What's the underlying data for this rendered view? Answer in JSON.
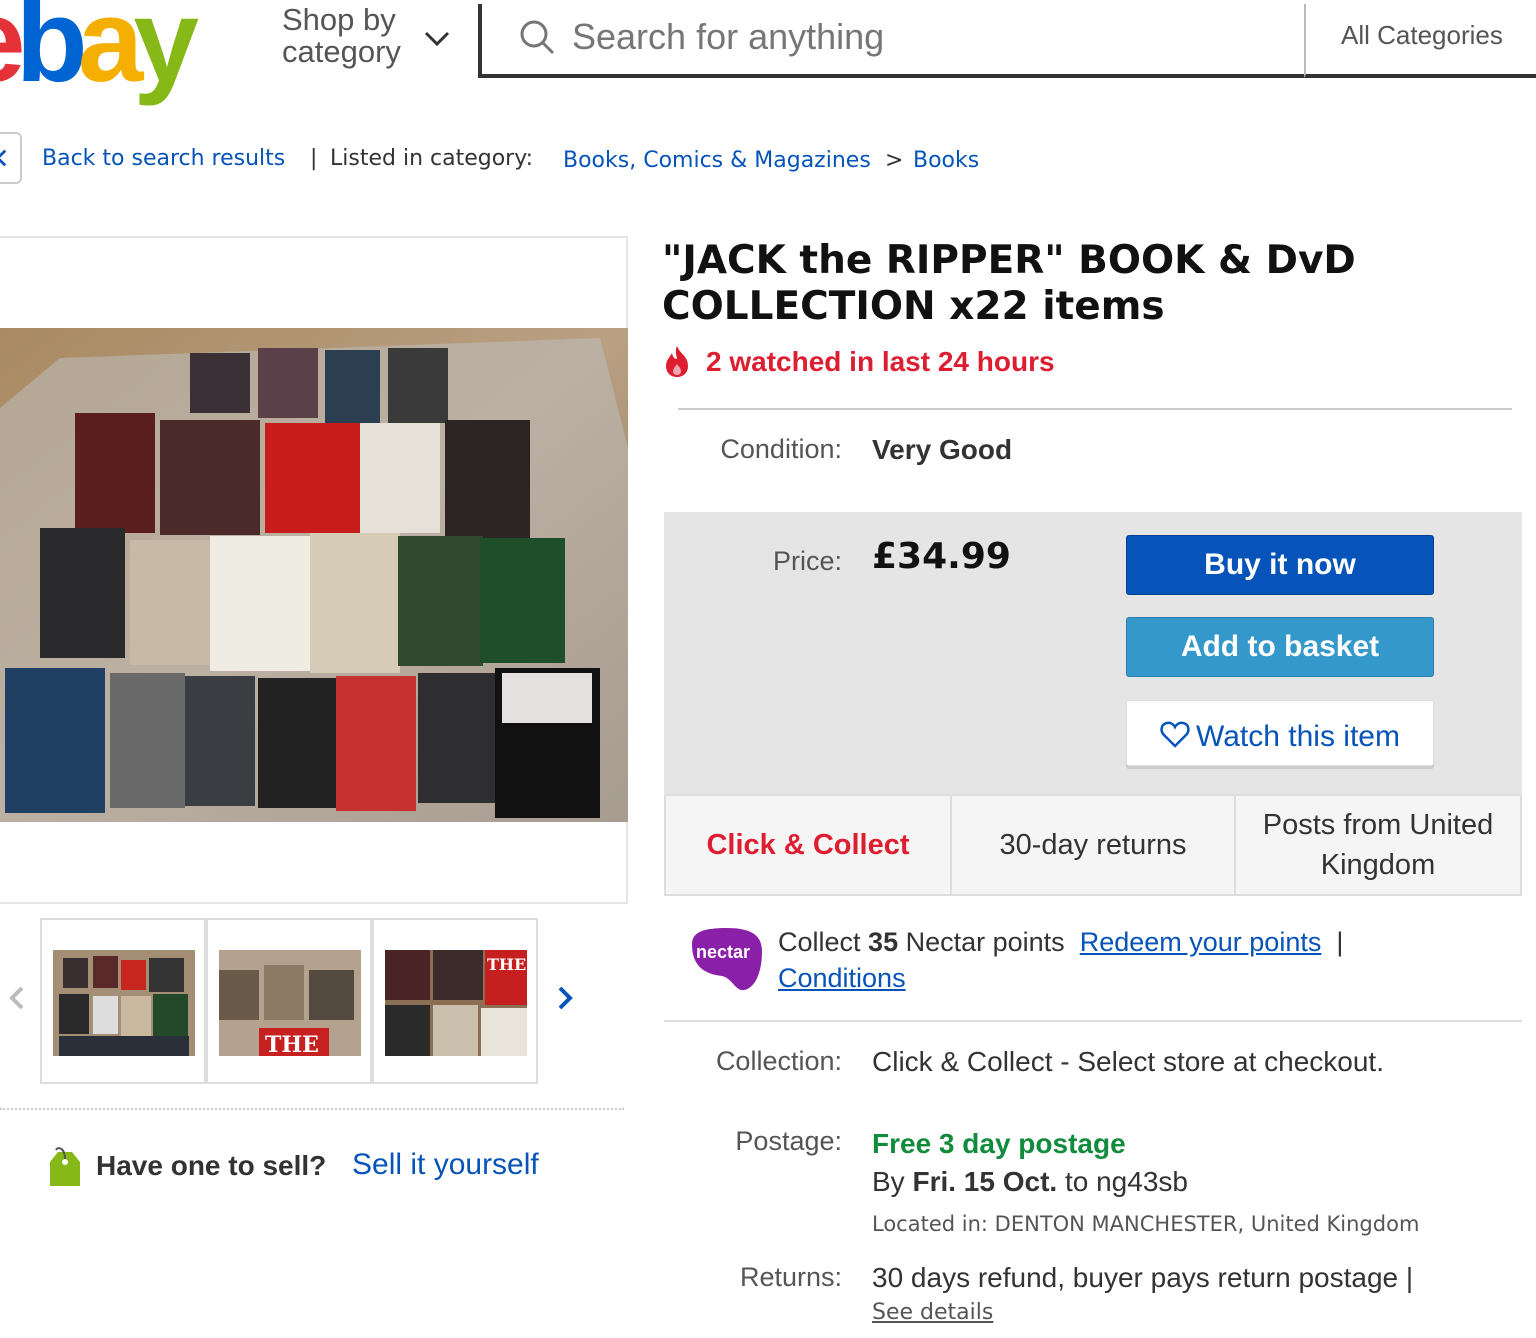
{
  "header": {
    "logo": {
      "e": "e",
      "b": "b",
      "a": "a",
      "y": "y"
    },
    "shop_by_line1": "Shop by",
    "shop_by_line2": "category",
    "search_placeholder": "Search for anything",
    "all_categories": "All Categories"
  },
  "breadcrumb": {
    "back": "Back to search results",
    "separator": "|",
    "listed_in": "Listed in category:",
    "category": "Books, Comics & Magazines",
    "arrow": ">",
    "subcategory": "Books"
  },
  "listing": {
    "title": "\"JACK the RIPPER\" BOOK & DvD COLLECTION x22 items",
    "watched": "2 watched in last 24 hours",
    "condition_label": "Condition:",
    "condition_value": "Very Good",
    "price_label": "Price:",
    "price": "£34.99",
    "buy_now": "Buy it now",
    "add_basket": "Add to basket",
    "watch": "Watch this item"
  },
  "features": {
    "collect": "Click & Collect",
    "returns": "30-day returns",
    "posts": "Posts from United Kingdom"
  },
  "nectar": {
    "logo_text": "nectar",
    "collect_pre": "Collect",
    "points": "35",
    "collect_post": "Nectar points",
    "redeem": "Redeem your points",
    "pipe": "|",
    "conditions": "Conditions"
  },
  "shipping": {
    "collection_label": "Collection:",
    "collection_value": "Click & Collect - Select store at checkout.",
    "postage_label": "Postage:",
    "postage_value": "Free 3 day postage",
    "by": "By",
    "date": "Fri. 15 Oct.",
    "to": "to ng43sb",
    "located_label": "Located in:",
    "located_value": "DENTON MANCHESTER, United Kingdom",
    "returns_label": "Returns:",
    "returns_value": "30 days refund, buyer pays return postage |",
    "see_details": "See details"
  },
  "sell": {
    "question": "Have one to sell?",
    "link": "Sell it yourself"
  },
  "colors": {
    "link": "#0654ba",
    "buy": "#0654ba",
    "basket": "#3498ca",
    "watched": "#dd1e31",
    "free_postage": "#118b3c",
    "nectar": "#8a1fa8"
  }
}
